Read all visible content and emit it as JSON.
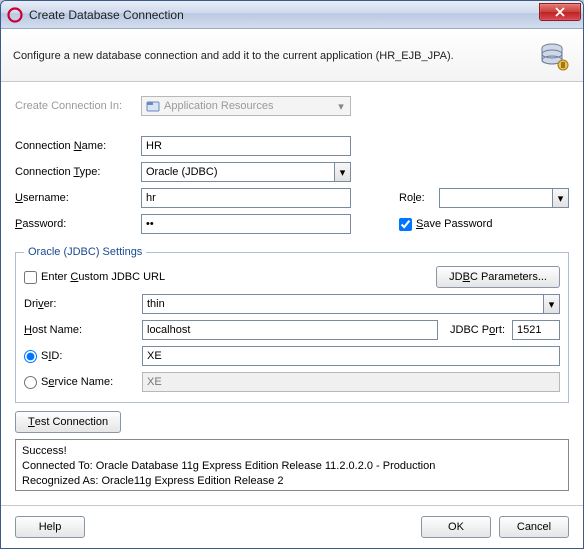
{
  "window": {
    "title": "Create Database Connection"
  },
  "header": {
    "text": "Configure a new database connection and add it to the current application (HR_EJB_JPA)."
  },
  "labels": {
    "create_in": "Create Connection In:",
    "create_in_value": "Application Resources",
    "connection_name": "Connection Name:",
    "connection_type": "Connection Type:",
    "username": "Username:",
    "password": "Password:",
    "role": "Role:",
    "save_password": "Save Password",
    "fieldset": "Oracle (JDBC) Settings",
    "enter_custom": "Enter Custom JDBC URL",
    "jdbc_params": "JDBC Parameters...",
    "driver": "Driver:",
    "host_name": "Host Name:",
    "jdbc_port": "JDBC Port:",
    "sid": "SID:",
    "service_name": "Service Name:",
    "service_placeholder": "XE",
    "test_connection": "Test Connection"
  },
  "values": {
    "connection_name": "HR",
    "connection_type": "Oracle (JDBC)",
    "username": "hr",
    "password": "••",
    "role": "",
    "save_password_checked": true,
    "enter_custom_checked": false,
    "driver": "thin",
    "host_name": "localhost",
    "jdbc_port": "1521",
    "sid_selected": true,
    "sid": "XE",
    "service_name": ""
  },
  "results": {
    "line1": "Success!",
    "line2": "Connected To: Oracle Database 11g Express Edition Release 11.2.0.2.0 - Production",
    "line3": "Recognized As: Oracle11g Express Edition Release 2"
  },
  "footer": {
    "help": "Help",
    "ok": "OK",
    "cancel": "Cancel"
  }
}
